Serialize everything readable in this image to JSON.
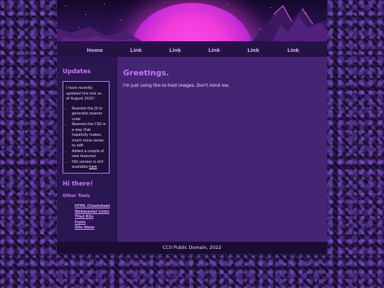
{
  "nav": {
    "items": [
      {
        "label": "Home"
      },
      {
        "label": "Link"
      },
      {
        "label": "Link"
      },
      {
        "label": "Link"
      },
      {
        "label": "Link"
      },
      {
        "label": "Link"
      }
    ]
  },
  "sidebar": {
    "updates_title": "Updates",
    "updates_intro": "I have recently updated this tool as of August 2022!",
    "updates_items": [
      "Rewrote the JS to generate cleaner code",
      "Rewrote the CSS in a way that hopefully makes much more sense to edit",
      "Added a couple of new features!"
    ],
    "updates_old_text": "Old version is still available",
    "updates_old_link": "here",
    "hi_title": "Hi there!",
    "tools_title": "Other Tools",
    "tools": [
      {
        "label": "HTML Cheatsheet"
      },
      {
        "label": "Webmaster Links"
      },
      {
        "label": "Tiled BGs"
      },
      {
        "label": "Fonts"
      },
      {
        "label": "Site ideas"
      }
    ]
  },
  "main": {
    "heading": "Greetings.",
    "body": "I'm just using this to host images. Don't mind me."
  },
  "footer": {
    "text": "CC0 Public Domain, 2022"
  },
  "colors": {
    "accent": "#c675ff",
    "page_bg": "#1a0f33",
    "main_bg": "#452573",
    "sidebar_bg": "#2a1650",
    "sun": "#f03cd8"
  }
}
